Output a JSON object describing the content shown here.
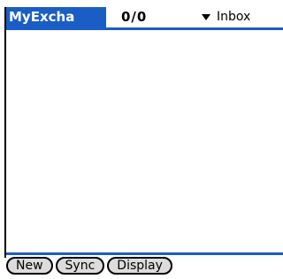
{
  "header": {
    "app_title": "MyExcha",
    "message_count": "0/0",
    "folder": {
      "selected": "Inbox",
      "icon": "dropdown-triangle-icon"
    }
  },
  "messages": [],
  "toolbar": {
    "buttons": [
      "New",
      "Sync",
      "Display"
    ]
  },
  "colors": {
    "accent": "#1a5ec5",
    "button_fill": "#dcdcdc",
    "background": "#ffffff"
  }
}
